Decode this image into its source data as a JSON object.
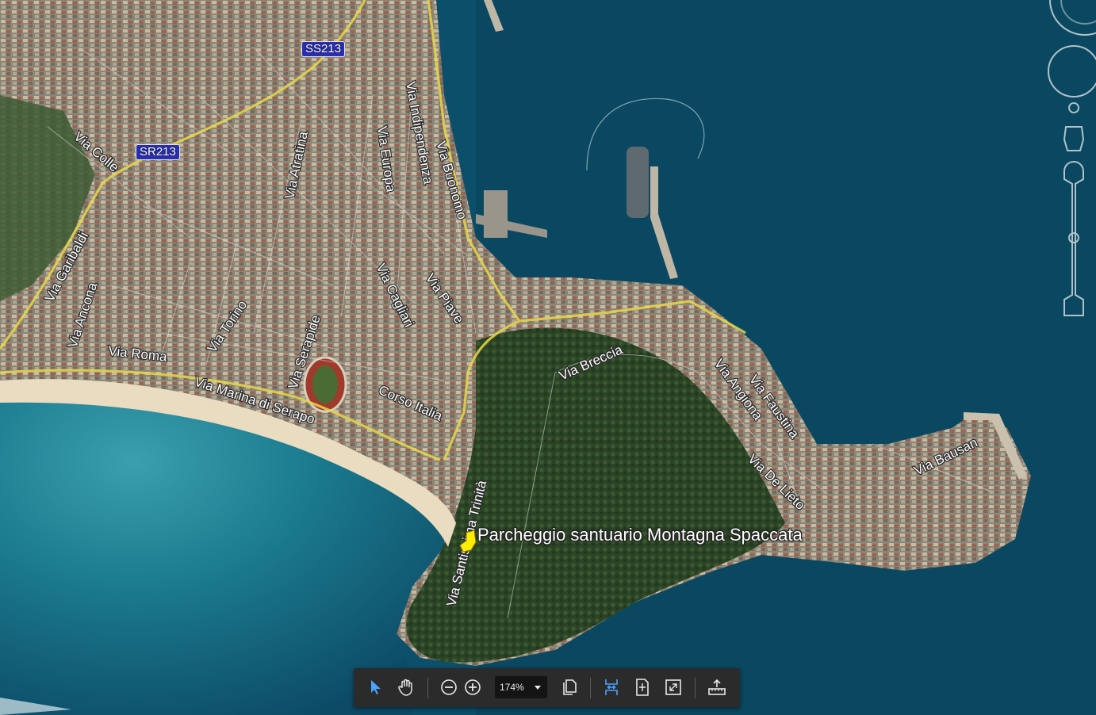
{
  "map": {
    "placemark": {
      "label": "Parcheggio santuario Montagna Spaccata",
      "color": "#ffee00"
    },
    "route_shields": [
      "SS213",
      "SR213"
    ],
    "street_labels": [
      "Via Colle",
      "Via Garibaldi",
      "Via Ancona",
      "Via Roma",
      "Via Torino",
      "Via Serapide",
      "Via Marina di Serapo",
      "Via Atratina",
      "Via Europa",
      "Via Indipendenza",
      "Via Buonomo",
      "Via Cagliari",
      "Via Piave",
      "Corso Italia",
      "Via Breccia",
      "Via Santissima Trinità",
      "Via Angiona",
      "Via Faustina",
      "Via De Lieto",
      "Via Bausan"
    ]
  },
  "toolbar": {
    "zoom_value": "174%",
    "icons": [
      "select-arrow-icon",
      "hand-pan-icon",
      "zoom-out-icon",
      "zoom-in-icon",
      "pages-icon",
      "fit-width-icon",
      "fit-page-icon",
      "fullscreen-icon",
      "measure-icon"
    ],
    "active_color": "#4aa3ff"
  }
}
